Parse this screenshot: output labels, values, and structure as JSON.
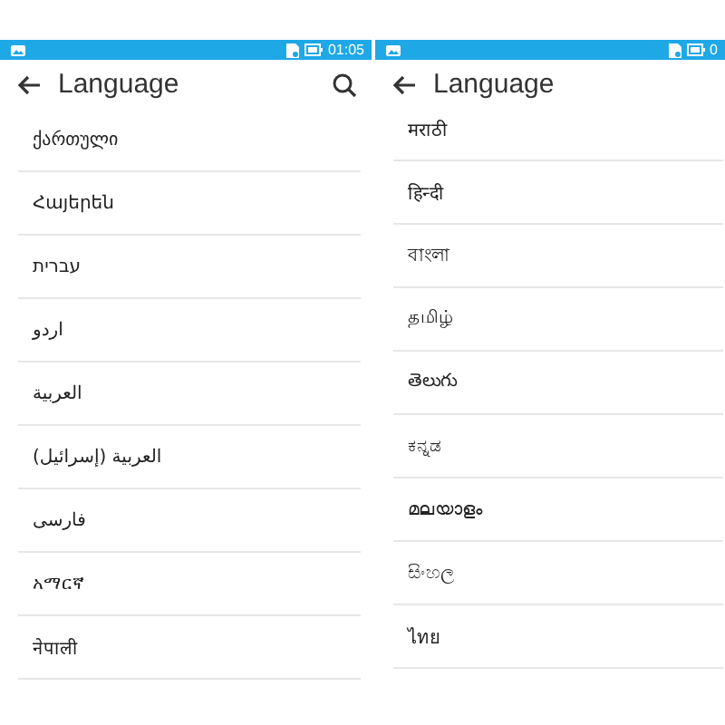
{
  "panels": [
    {
      "status_bar": {
        "time": "01:05"
      },
      "title": "Language",
      "search": true,
      "items": [
        "ქართული",
        "Հայերեն",
        "עברית",
        "اردو",
        "العربية",
        "العربية (إسرائيل)",
        "فارسی",
        "አማርኛ",
        "नेपाली"
      ]
    },
    {
      "status_bar": {
        "time": "0"
      },
      "title": "Language",
      "search": false,
      "items": [
        "मराठी",
        "हिन्दी",
        "বাংলা",
        "தமிழ்",
        "తెలుగు",
        "ಕನ್ನಡ",
        "മലയാളം",
        "සිංහල",
        "ไทย"
      ]
    }
  ]
}
